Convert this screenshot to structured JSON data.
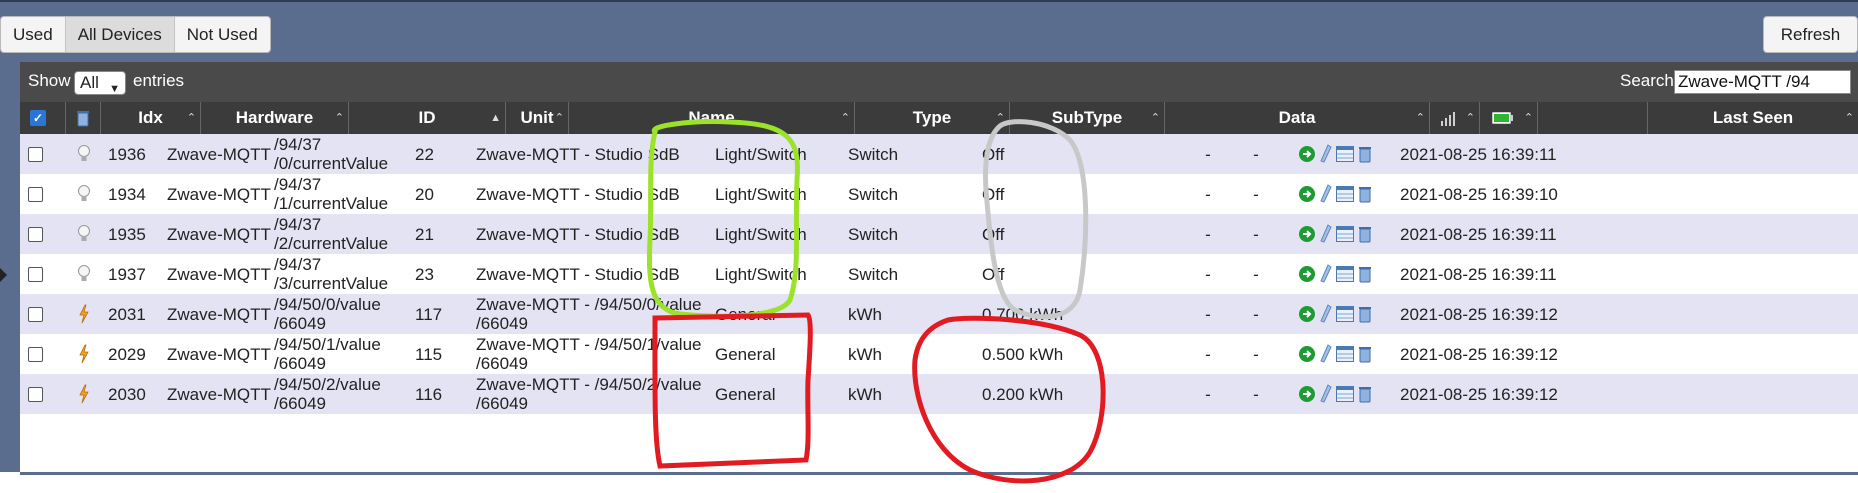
{
  "filters": [
    "Used",
    "All Devices",
    "Not Used"
  ],
  "refresh_label": "Refresh",
  "controls": {
    "show_label": "Show",
    "show_value": "All",
    "entries_label": "entries",
    "search_label": "Search:",
    "search_value": "Zwave-MQTT /94"
  },
  "columns": {
    "idx": "Idx",
    "hardware": "Hardware",
    "id": "ID",
    "unit": "Unit",
    "name": "Name",
    "type": "Type",
    "subtype": "SubType",
    "data": "Data",
    "last_seen": "Last Seen"
  },
  "rows": [
    {
      "icon": "bulb-icon",
      "idx": "1936",
      "hardware": "Zwave-MQTT",
      "id_l1": "/94/37",
      "id_l2": "/0/currentValue",
      "unit": "22",
      "name_l1": "Zwave-MQTT - Studio SdB",
      "name_l2": "",
      "type": "Light/Switch",
      "subtype": "Switch",
      "data": "Off",
      "signal": "-",
      "battery": "-",
      "last_seen": "2021-08-25 16:39:11"
    },
    {
      "icon": "bulb-icon",
      "idx": "1934",
      "hardware": "Zwave-MQTT",
      "id_l1": "/94/37",
      "id_l2": "/1/currentValue",
      "unit": "20",
      "name_l1": "Zwave-MQTT - Studio SdB",
      "name_l2": "",
      "type": "Light/Switch",
      "subtype": "Switch",
      "data": "Off",
      "signal": "-",
      "battery": "-",
      "last_seen": "2021-08-25 16:39:10"
    },
    {
      "icon": "bulb-icon",
      "idx": "1935",
      "hardware": "Zwave-MQTT",
      "id_l1": "/94/37",
      "id_l2": "/2/currentValue",
      "unit": "21",
      "name_l1": "Zwave-MQTT - Studio SdB",
      "name_l2": "",
      "type": "Light/Switch",
      "subtype": "Switch",
      "data": "Off",
      "signal": "-",
      "battery": "-",
      "last_seen": "2021-08-25 16:39:11"
    },
    {
      "icon": "bulb-icon",
      "idx": "1937",
      "hardware": "Zwave-MQTT",
      "id_l1": "/94/37",
      "id_l2": "/3/currentValue",
      "unit": "23",
      "name_l1": "Zwave-MQTT - Studio SdB",
      "name_l2": "",
      "type": "Light/Switch",
      "subtype": "Switch",
      "data": "Off",
      "signal": "-",
      "battery": "-",
      "last_seen": "2021-08-25 16:39:11"
    },
    {
      "icon": "energy-icon",
      "idx": "2031",
      "hardware": "Zwave-MQTT",
      "id_l1": "/94/50/0/value",
      "id_l2": "/66049",
      "unit": "117",
      "name_l1": "Zwave-MQTT - /94/50/0/value",
      "name_l2": "/66049",
      "type": "General",
      "subtype": "kWh",
      "data": "0.700 kWh",
      "signal": "-",
      "battery": "-",
      "last_seen": "2021-08-25 16:39:12"
    },
    {
      "icon": "energy-icon",
      "idx": "2029",
      "hardware": "Zwave-MQTT",
      "id_l1": "/94/50/1/value",
      "id_l2": "/66049",
      "unit": "115",
      "name_l1": "Zwave-MQTT - /94/50/1/value",
      "name_l2": "/66049",
      "type": "General",
      "subtype": "kWh",
      "data": "0.500 kWh",
      "signal": "-",
      "battery": "-",
      "last_seen": "2021-08-25 16:39:12"
    },
    {
      "icon": "energy-icon",
      "idx": "2030",
      "hardware": "Zwave-MQTT",
      "id_l1": "/94/50/2/value",
      "id_l2": "/66049",
      "unit": "116",
      "name_l1": "Zwave-MQTT - /94/50/2/value",
      "name_l2": "/66049",
      "type": "General",
      "subtype": "kWh",
      "data": "0.200 kWh",
      "signal": "-",
      "battery": "-",
      "last_seen": "2021-08-25 16:39:12"
    }
  ],
  "annotations": [
    {
      "name": "name-green-circle",
      "color": "#9be22a"
    },
    {
      "name": "subtype-gray-circle",
      "color": "#c8c8c8"
    },
    {
      "name": "name-red-box",
      "color": "#e01b22"
    },
    {
      "name": "subtype-red-circle",
      "color": "#e01b22"
    }
  ]
}
